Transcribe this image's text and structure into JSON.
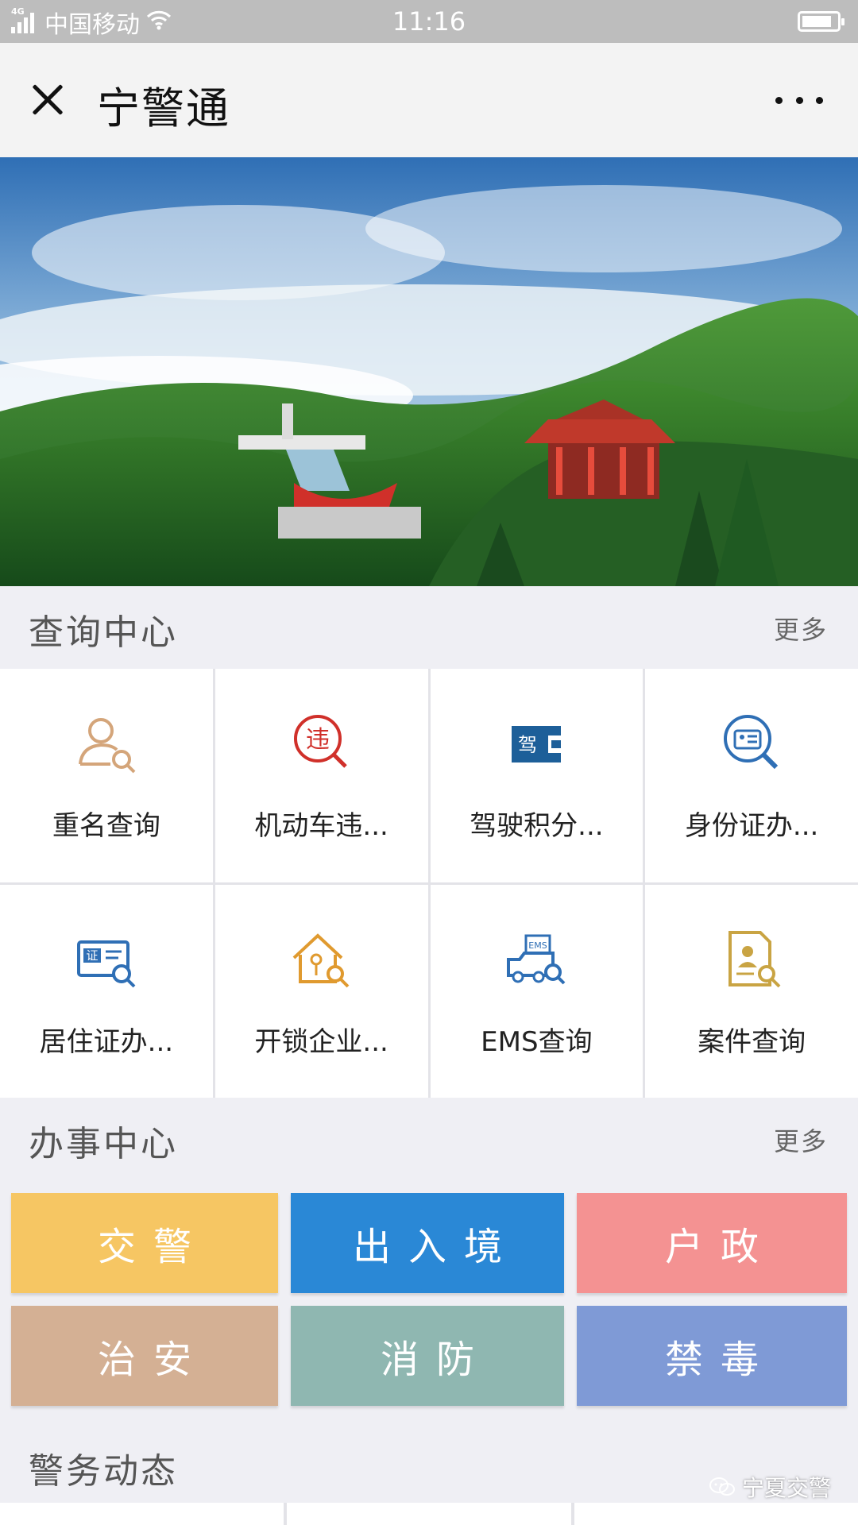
{
  "status_bar": {
    "network": "4G",
    "carrier": "中国移动",
    "time": "11:16"
  },
  "title_bar": {
    "title": "宁警通"
  },
  "query_center": {
    "title": "查询中心",
    "more": "更多",
    "items": [
      {
        "label": "重名查询",
        "icon": "person-search-icon"
      },
      {
        "label": "机动车违...",
        "icon": "violation-search-icon"
      },
      {
        "label": "驾驶积分...",
        "icon": "driver-license-icon"
      },
      {
        "label": "身份证办...",
        "icon": "id-card-search-icon"
      },
      {
        "label": "居住证办...",
        "icon": "residence-permit-search-icon"
      },
      {
        "label": "开锁企业...",
        "icon": "lock-company-search-icon"
      },
      {
        "label": "EMS查询",
        "icon": "ems-truck-search-icon"
      },
      {
        "label": "案件查询",
        "icon": "case-document-search-icon"
      }
    ],
    "icon_texts": {
      "violation": "违",
      "license": "驾",
      "residence": "证",
      "ems": "EMS"
    }
  },
  "service_center": {
    "title": "办事中心",
    "more": "更多",
    "items": [
      {
        "label": "交警",
        "color": "#f6c663"
      },
      {
        "label": "出入境",
        "color": "#2a88d6"
      },
      {
        "label": "户政",
        "color": "#f49292"
      },
      {
        "label": "治安",
        "color": "#d4b094"
      },
      {
        "label": "消防",
        "color": "#8fb7b1"
      },
      {
        "label": "禁毒",
        "color": "#7f9ad6"
      }
    ]
  },
  "news": {
    "title": "警务动态"
  },
  "watermark": {
    "text": "宁夏交警"
  }
}
